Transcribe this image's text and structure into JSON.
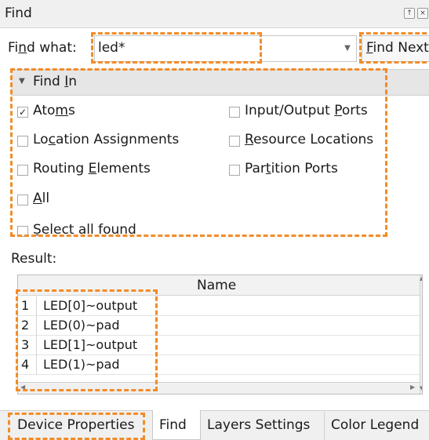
{
  "panel": {
    "title": "Find"
  },
  "find_what": {
    "label_pre": "Fi",
    "label_u": "n",
    "label_post": "d what:",
    "value": "led*",
    "find_next_u": "F",
    "find_next_rest": "ind Next"
  },
  "find_in": {
    "header_pre": "Find ",
    "header_u": "I",
    "header_post": "n",
    "options": [
      {
        "pre": "Ato",
        "u": "m",
        "post": "s",
        "checked": true
      },
      {
        "pre": "Input/Output ",
        "u": "P",
        "post": "orts",
        "checked": false
      },
      {
        "pre": "Lo",
        "u": "c",
        "post": "ation Assignments",
        "checked": false
      },
      {
        "pre": "",
        "u": "R",
        "post": "esource Locations",
        "checked": false
      },
      {
        "pre": "Routing ",
        "u": "E",
        "post": "lements",
        "checked": false
      },
      {
        "pre": "Par",
        "u": "t",
        "post": "ition Ports",
        "checked": false
      },
      {
        "pre": "",
        "u": "A",
        "post": "ll",
        "checked": false
      }
    ],
    "select_all": {
      "pre": "",
      "u": "S",
      "post": "elect all found",
      "checked": false
    }
  },
  "result": {
    "label": "Result:",
    "column": "Name",
    "rows": [
      {
        "num": "1",
        "name": "LED[0]~output"
      },
      {
        "num": "2",
        "name": "LED(0)~pad"
      },
      {
        "num": "3",
        "name": "LED[1]~output"
      },
      {
        "num": "4",
        "name": "LED(1)~pad"
      }
    ]
  },
  "tabs": [
    "Device Properties",
    "Find",
    "Layers Settings",
    "Color Legend"
  ],
  "active_tab": "Find",
  "highlight_color": "#f28c28"
}
